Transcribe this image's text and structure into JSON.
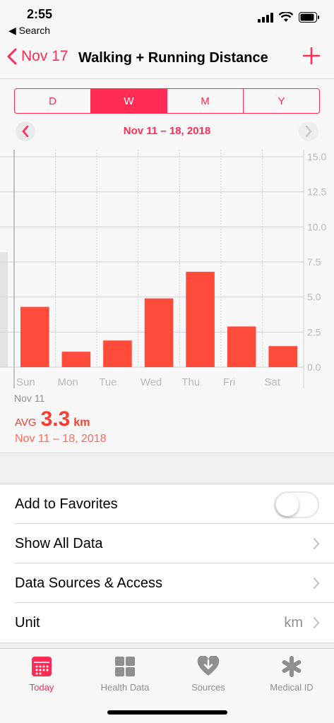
{
  "status": {
    "time": "2:55",
    "back_app": "◀ Search"
  },
  "nav": {
    "back_label": "Nov 17",
    "title": "Walking + Running Distance"
  },
  "segments": [
    "D",
    "W",
    "M",
    "Y"
  ],
  "active_segment": "W",
  "range_label": "Nov 11 – 18, 2018",
  "chart_data": {
    "type": "bar",
    "categories": [
      "Sun",
      "Mon",
      "Tue",
      "Wed",
      "Thu",
      "Fri",
      "Sat"
    ],
    "values": [
      4.3,
      1.1,
      1.9,
      4.9,
      6.8,
      2.9,
      1.5
    ],
    "y_ticks": [
      "15.0",
      "12.5",
      "10.0",
      "7.5",
      "5.0",
      "2.5",
      "0.0"
    ],
    "ylim": [
      0,
      15
    ],
    "sub_label": "Nov 11",
    "bar_color": "#ff4b3a"
  },
  "summary": {
    "avg_label": "AVG",
    "avg_value": "3.3",
    "avg_unit": "km",
    "range": "Nov 11 – 18, 2018"
  },
  "list": {
    "favorites": "Add to Favorites",
    "show_all": "Show All Data",
    "sources": "Data Sources & Access",
    "unit": "Unit",
    "unit_value": "km"
  },
  "tabs": [
    {
      "label": "Today",
      "icon": "calendar-icon"
    },
    {
      "label": "Health Data",
      "icon": "grid-icon"
    },
    {
      "label": "Sources",
      "icon": "heart-download-icon"
    },
    {
      "label": "Medical ID",
      "icon": "asterisk-icon"
    }
  ],
  "colors": {
    "accent": "#ff2d55",
    "bar": "#ff4b3a"
  }
}
